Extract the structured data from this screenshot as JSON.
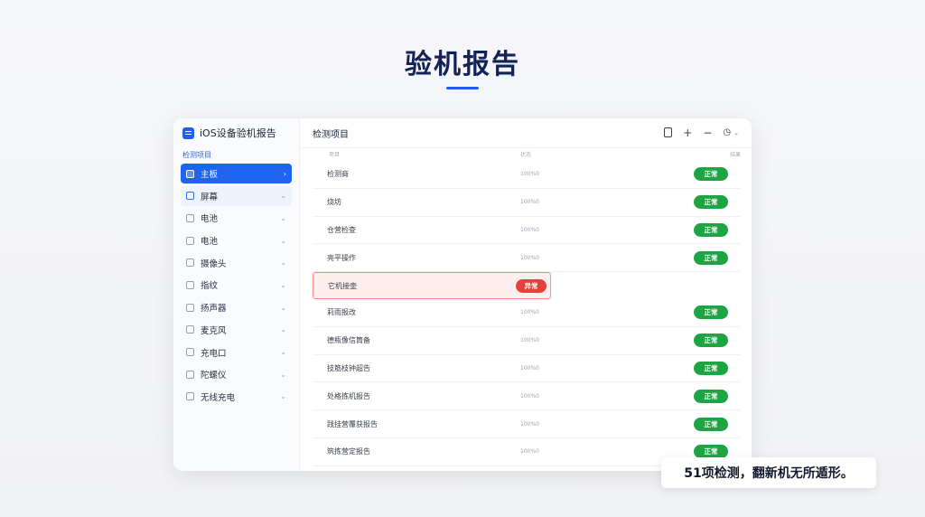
{
  "page": {
    "title": "验机报告",
    "caption": "51项检测，翻新机无所遁形。"
  },
  "window": {
    "app_title": "iOS设备验机报告",
    "section_label": "检测项目",
    "main_title": "检测项目",
    "toolbar": {
      "doc_icon": "document-icon",
      "add_label": "+",
      "remove_label": "−",
      "clock_icon": "clock-icon"
    },
    "columns": [
      "项目",
      "状态",
      "结果"
    ]
  },
  "sidebar": {
    "items": [
      {
        "label": "主板",
        "active": true
      },
      {
        "label": "屏幕"
      },
      {
        "label": "电池"
      },
      {
        "label": "电池"
      },
      {
        "label": "摄像头"
      },
      {
        "label": "指纹"
      },
      {
        "label": "扬声器"
      },
      {
        "label": "麦克风"
      },
      {
        "label": "充电口"
      },
      {
        "label": "陀螺仪"
      },
      {
        "label": "无线充电"
      }
    ]
  },
  "rows": [
    {
      "name": "检测商",
      "detail": "100%0",
      "status": "正常"
    },
    {
      "name": "烧坊",
      "detail": "100%0",
      "status": "正常"
    },
    {
      "name": "仓营检查",
      "detail": "100%0",
      "status": "正常"
    },
    {
      "name": "亮平操作",
      "detail": "100%0",
      "status": "正常"
    },
    {
      "name": "它机接壶",
      "detail": "",
      "status": "异常"
    },
    {
      "name": "莉雨报改",
      "detail": "100%0",
      "status": "正常"
    },
    {
      "name": "德瓶像信筒备",
      "detail": "100%0",
      "status": "正常"
    },
    {
      "name": "技筋枝钟超告",
      "detail": "100%0",
      "status": "正常"
    },
    {
      "name": "处格拣机报告",
      "detail": "100%0",
      "status": "正常"
    },
    {
      "name": "践挂营覆获报告",
      "detail": "100%0",
      "status": "正常"
    },
    {
      "name": "筑拣营定报告",
      "detail": "100%0",
      "status": "正常"
    }
  ],
  "colors": {
    "accent": "#1e64f0",
    "ok": "#1fa443",
    "error": "#e7403b",
    "title": "#142356"
  }
}
